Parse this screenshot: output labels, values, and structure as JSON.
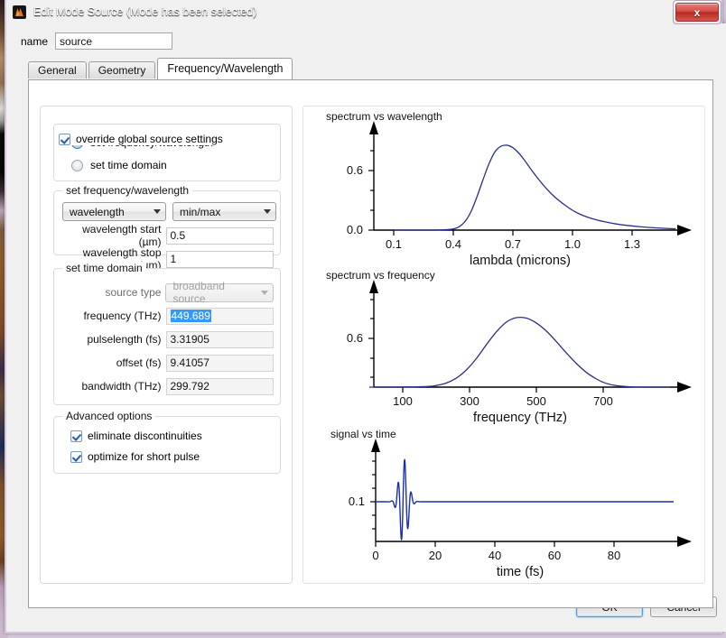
{
  "window": {
    "title": "Edit Mode Source (Mode has been selected)",
    "icon": "lumerical-logo-icon",
    "close_label": "x"
  },
  "name_field": {
    "label": "name",
    "value": "source"
  },
  "tabs": [
    {
      "label": "General",
      "active": false
    },
    {
      "label": "Geometry",
      "active": false
    },
    {
      "label": "Frequency/Wavelength",
      "active": true
    }
  ],
  "override": {
    "label": "override global source settings",
    "checked": true
  },
  "mode_radios": [
    {
      "label": "set frequency/wavelength",
      "selected": true
    },
    {
      "label": "set time domain",
      "selected": false
    }
  ],
  "freq_wavelength_group": {
    "legend": "set frequency/wavelength",
    "quantity_select": {
      "value": "wavelength"
    },
    "range_select": {
      "value": "min/max"
    },
    "fields": [
      {
        "label": "wavelength start (µm)",
        "value": "0.5"
      },
      {
        "label": "wavelength stop (µm)",
        "value": "1"
      }
    ]
  },
  "time_domain_group": {
    "legend": "set time domain",
    "source_type": {
      "label": "source type",
      "value": "broadband source",
      "disabled": true
    },
    "fields": [
      {
        "label": "frequency (THz)",
        "value": "449.689",
        "selected": true
      },
      {
        "label": "pulselength (fs)",
        "value": "3.31905",
        "selected": false
      },
      {
        "label": "offset (fs)",
        "value": "9.41057",
        "selected": false
      },
      {
        "label": "bandwidth (THz)",
        "value": "299.792",
        "selected": false
      }
    ]
  },
  "advanced_group": {
    "legend": "Advanced options",
    "options": [
      {
        "label": "eliminate discontinuities",
        "checked": true
      },
      {
        "label": "optimize for short pulse",
        "checked": true
      }
    ]
  },
  "footer": {
    "ok": "OK",
    "cancel": "Cancel"
  },
  "colors": {
    "curve": "#2b2f8f",
    "signal": "#1a2fb0",
    "selection": "#3399ff",
    "accent": "#5b9bd5"
  },
  "chart_data": [
    {
      "type": "line",
      "title": "spectrum vs wavelength",
      "xlabel": "lambda (microns)",
      "ylabel": "",
      "xticks": [
        0.1,
        0.4,
        0.7,
        1.0,
        1.3
      ],
      "xticklabels": [
        "0.1",
        "0.4",
        "0.7",
        "1.0",
        "1.3"
      ],
      "yticks": [
        0.0,
        0.6
      ],
      "yticklabels": [
        "0.0",
        "0.6"
      ],
      "xlim": [
        0.0,
        1.55
      ],
      "ylim": [
        0.0,
        1.0
      ],
      "x": [
        0.1,
        0.2,
        0.3,
        0.36,
        0.4,
        0.43,
        0.46,
        0.49,
        0.52,
        0.55,
        0.58,
        0.61,
        0.64,
        0.67,
        0.7,
        0.73,
        0.76,
        0.79,
        0.83,
        0.87,
        0.91,
        0.95,
        1.0,
        1.05,
        1.1,
        1.16,
        1.22,
        1.28,
        1.34,
        1.4,
        1.46,
        1.52
      ],
      "y": [
        0.0,
        0.0,
        0.0,
        0.004,
        0.012,
        0.035,
        0.09,
        0.19,
        0.34,
        0.51,
        0.67,
        0.79,
        0.845,
        0.855,
        0.83,
        0.775,
        0.7,
        0.615,
        0.51,
        0.415,
        0.335,
        0.27,
        0.2,
        0.15,
        0.115,
        0.085,
        0.062,
        0.046,
        0.034,
        0.025,
        0.018,
        0.013
      ]
    },
    {
      "type": "line",
      "title": "spectrum vs frequency",
      "xlabel": "frequency (THz)",
      "ylabel": "",
      "xticks": [
        100,
        300,
        500,
        700
      ],
      "xticklabels": [
        "100",
        "300",
        "500",
        "700"
      ],
      "yticks": [
        0.6
      ],
      "yticklabels": [
        "0.6"
      ],
      "xlim": [
        0,
        900
      ],
      "ylim": [
        0.0,
        1.0
      ],
      "x": [
        0,
        60,
        120,
        180,
        200,
        230,
        260,
        290,
        320,
        350,
        380,
        410,
        440,
        470,
        500,
        530,
        560,
        590,
        620,
        650,
        680,
        700,
        730,
        780,
        840,
        900
      ],
      "y": [
        0.0,
        0.0,
        0.002,
        0.01,
        0.02,
        0.05,
        0.11,
        0.21,
        0.35,
        0.52,
        0.68,
        0.8,
        0.855,
        0.85,
        0.79,
        0.69,
        0.56,
        0.42,
        0.29,
        0.18,
        0.1,
        0.06,
        0.025,
        0.004,
        0.0,
        0.0
      ]
    },
    {
      "type": "line",
      "title": "signal vs time",
      "xlabel": "time (fs)",
      "ylabel": "",
      "xticks": [
        0,
        20,
        40,
        60,
        80
      ],
      "xticklabels": [
        "0",
        "20",
        "40",
        "60",
        "80"
      ],
      "yticks": [
        0.1
      ],
      "yticklabels": [
        "0.1"
      ],
      "xlim": [
        0,
        100
      ],
      "ylim": [
        -0.75,
        1.0
      ],
      "baseline": 0.1,
      "description": "damped oscillatory pulse centered near t = 9.4 fs, flat baseline after t ≈ 15 fs"
    }
  ]
}
